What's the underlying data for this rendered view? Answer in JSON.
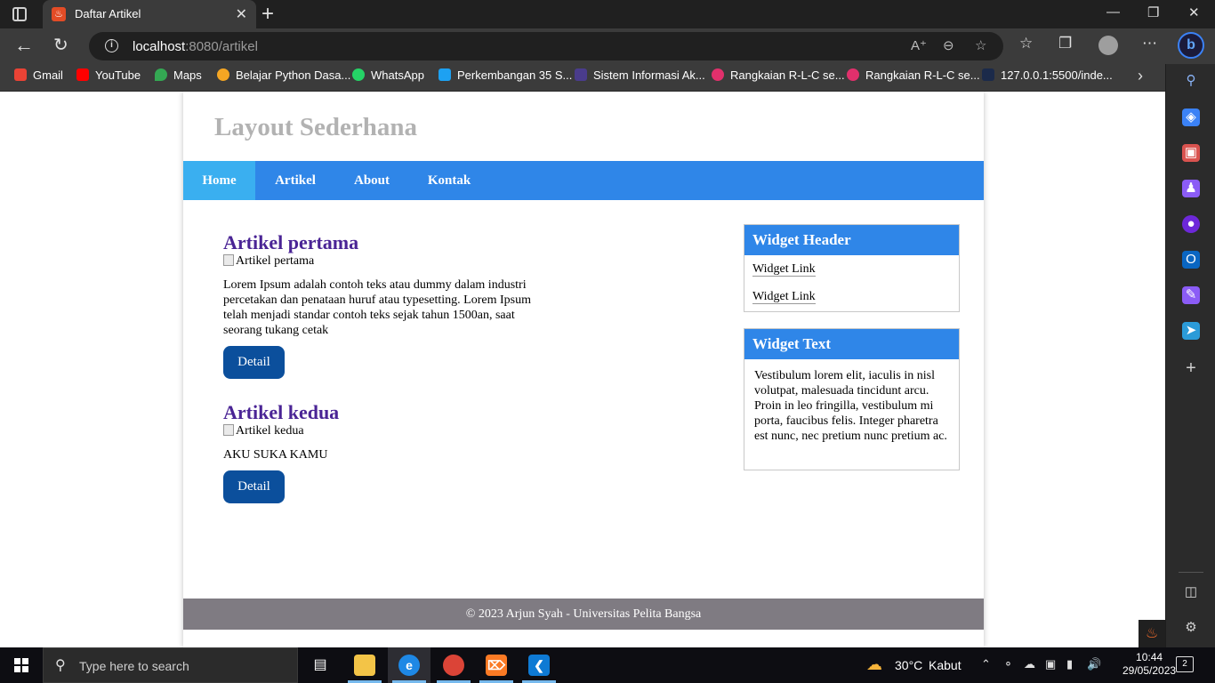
{
  "browser": {
    "tab_title": "Daftar Artikel",
    "url_host": "localhost",
    "url_path": ":8080/artikel",
    "bookmarks": [
      {
        "label": "Gmail",
        "color": "#ea4335"
      },
      {
        "label": "YouTube",
        "color": "#ff0000"
      },
      {
        "label": "Maps",
        "color": "#34a853"
      },
      {
        "label": "Belajar Python Dasa...",
        "color": "#f5a623"
      },
      {
        "label": "WhatsApp",
        "color": "#25d366"
      },
      {
        "label": "Perkembangan 35 S...",
        "color": "#1da1f2"
      },
      {
        "label": "Sistem Informasi Ak...",
        "color": "#4a3c8c"
      },
      {
        "label": "Rangkaian R-L-C se...",
        "color": "#e1306c"
      },
      {
        "label": "Rangkaian R-L-C se...",
        "color": "#e1306c"
      },
      {
        "label": "127.0.0.1:5500/inde...",
        "color": "#1b2a4a"
      }
    ]
  },
  "site": {
    "title": "Layout Sederhana",
    "nav": [
      "Home",
      "Artikel",
      "About",
      "Kontak"
    ],
    "active_nav": "Home",
    "articles": [
      {
        "title": "Artikel pertama",
        "image_alt": "Artikel pertama",
        "body": "Lorem Ipsum adalah contoh teks atau dummy dalam industri percetakan dan penataan huruf atau typesetting. Lorem Ipsum telah menjadi standar contoh teks sejak tahun 1500an, saat seorang tukang cetak",
        "button": "Detail"
      },
      {
        "title": "Artikel kedua",
        "image_alt": "Artikel kedua",
        "body": "AKU SUKA KAMU",
        "button": "Detail"
      }
    ],
    "widget_links": {
      "header": "Widget Header",
      "links": [
        "Widget Link",
        "Widget Link"
      ]
    },
    "widget_text": {
      "header": "Widget Text",
      "body": "Vestibulum lorem elit, iaculis in nisl volutpat, malesuada tincidunt arcu. Proin in leo fringilla, vestibulum mi porta, faucibus felis. Integer pharetra est nunc, nec pretium nunc pretium ac."
    },
    "footer": "© 2023 Arjun Syah - Universitas Pelita Bangsa"
  },
  "taskbar": {
    "search_placeholder": "Type here to search",
    "weather_temp": "30°C",
    "weather_desc": "Kabut",
    "time": "10:44",
    "date": "29/05/2023",
    "notification_count": "2"
  },
  "colors": {
    "nav_bg": "#2f86e8",
    "nav_active": "#3aaff0",
    "article_title": "#4a2495",
    "button_bg": "#0b4f9c",
    "footer_bg": "#7f7b82"
  }
}
